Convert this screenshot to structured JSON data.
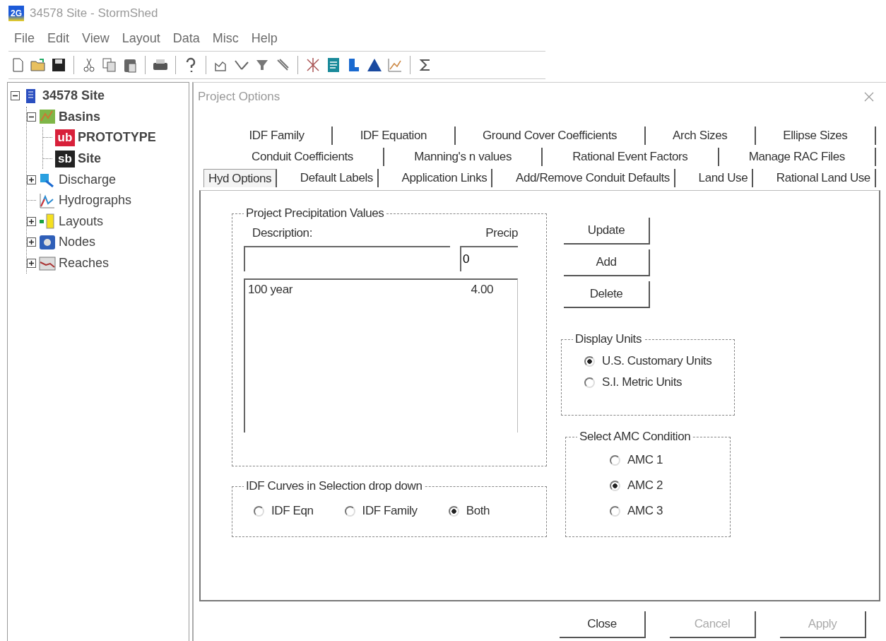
{
  "window": {
    "app_icon_text": "2G",
    "title": "34578 Site - StormShed"
  },
  "menu": [
    "File",
    "Edit",
    "View",
    "Layout",
    "Data",
    "Misc",
    "Help"
  ],
  "tree": [
    {
      "label": "34578 Site",
      "kind": "project",
      "expanded": true,
      "children": [
        {
          "label": "Basins",
          "kind": "basins",
          "expanded": true,
          "children": [
            {
              "label": "PROTOTYPE",
              "kind": "basin",
              "badge": "ub",
              "color": "#d8203a"
            },
            {
              "label": "Site",
              "kind": "basin",
              "badge": "sb",
              "color": "#222222"
            }
          ]
        },
        {
          "label": "Discharge",
          "kind": "discharge",
          "expanded": false
        },
        {
          "label": "Hydrographs",
          "kind": "hydrographs"
        },
        {
          "label": "Layouts",
          "kind": "layouts",
          "expanded": false
        },
        {
          "label": "Nodes",
          "kind": "nodes",
          "expanded": false
        },
        {
          "label": "Reaches",
          "kind": "reaches",
          "expanded": false
        }
      ]
    }
  ],
  "dialog": {
    "title": "Project Options",
    "tab_rows": [
      [
        {
          "label": "IDF Family",
          "selected": false
        },
        {
          "label": "IDF Equation",
          "selected": false
        },
        {
          "label": "Ground Cover Coefficients",
          "selected": false
        },
        {
          "label": "Arch Sizes",
          "selected": false
        },
        {
          "label": "Ellipse Sizes",
          "selected": false
        }
      ],
      [
        {
          "label": "Conduit Coefficients",
          "selected": false
        },
        {
          "label": "Manning's n values",
          "selected": false
        },
        {
          "label": "Rational Event Factors",
          "selected": false
        },
        {
          "label": "Manage RAC Files",
          "selected": false
        }
      ],
      [
        {
          "label": "Hyd Options",
          "selected": true
        },
        {
          "label": "Default Labels",
          "selected": false
        },
        {
          "label": "Application Links",
          "selected": false
        },
        {
          "label": "Add/Remove Conduit Defaults",
          "selected": false
        },
        {
          "label": "Land Use",
          "selected": false
        },
        {
          "label": "Rational Land Use",
          "selected": false
        }
      ]
    ],
    "precip_group": {
      "title": "Project Precipitation Values",
      "description_label": "Description:",
      "precip_label": "Precip",
      "precip_value": "0",
      "rows": [
        {
          "description": "100 year",
          "precip": "4.00"
        }
      ]
    },
    "idf_group": {
      "title": "IDF Curves in Selection drop down",
      "options": [
        {
          "label": "IDF Eqn",
          "selected": false
        },
        {
          "label": "IDF Family",
          "selected": false
        },
        {
          "label": "Both",
          "selected": true
        }
      ]
    },
    "side_buttons": [
      "Update",
      "Add",
      "Delete"
    ],
    "units_group": {
      "title": "Display Units",
      "options": [
        {
          "label": "U.S. Customary Units",
          "selected": true
        },
        {
          "label": "S.I. Metric Units",
          "selected": false
        }
      ]
    },
    "amc_group": {
      "title": "Select AMC Condition",
      "options": [
        {
          "label": "AMC 1",
          "selected": false
        },
        {
          "label": "AMC 2",
          "selected": true
        },
        {
          "label": "AMC 3",
          "selected": false
        }
      ]
    },
    "footer_buttons": [
      {
        "label": "Close",
        "disabled": false
      },
      {
        "label": "Cancel",
        "disabled": true
      },
      {
        "label": "Apply",
        "disabled": true
      }
    ]
  }
}
